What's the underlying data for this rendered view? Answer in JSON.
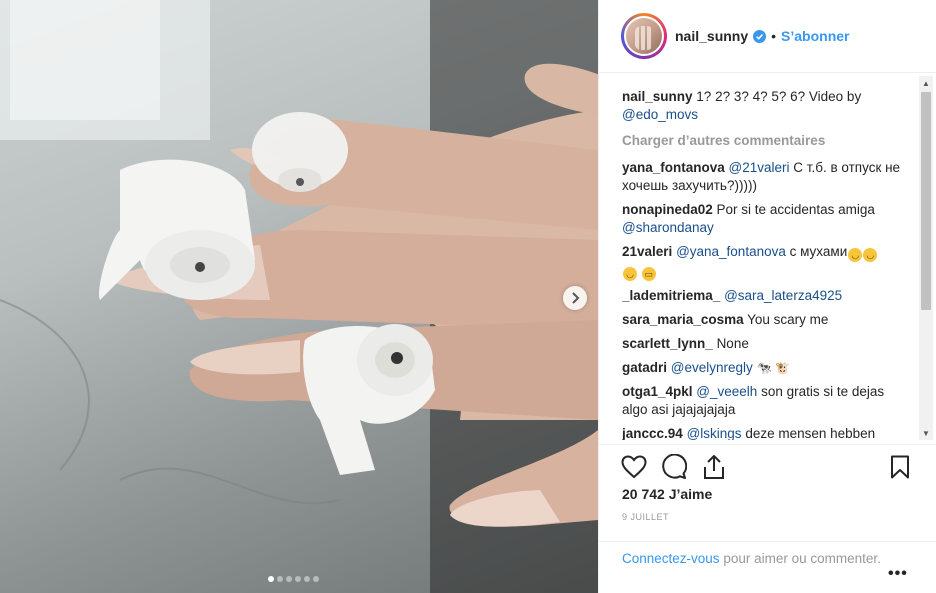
{
  "post": {
    "username": "nail_sunny",
    "separator": "•",
    "follow_label": "S’abonner"
  },
  "caption": {
    "user": "nail_sunny",
    "text": "1? 2? 3? 4? 5? 6? Video by",
    "mention": "@edo_movs"
  },
  "load_more_label": "Charger d’autres commentaires",
  "comments": [
    {
      "user": "yana_fontanova",
      "mention": "@21valeri",
      "text": "С т.б. в отпуск не хочешь захучить?)))))"
    },
    {
      "user": "nonapineda02",
      "text": "Por si te accidentas amiga",
      "mention": "@sharondanay"
    },
    {
      "user": "21valeri",
      "mention": "@yana_fontanova",
      "text": "с мухами"
    },
    {
      "user": "_lademitriema_",
      "mention": "@sara_laterza4925"
    },
    {
      "user": "sara_maria_cosma",
      "text": "You scary me"
    },
    {
      "user": "scarlett_lynn_",
      "text": "None"
    },
    {
      "user": "gatadri",
      "mention": "@evelynregly"
    },
    {
      "user": "otga1_4pkl",
      "mention": "@_veeelh",
      "text": "son gratis si te dejas algo asi jajajajajaja"
    },
    {
      "user": "janccc.94",
      "mention": "@lskings",
      "text": "deze mensen hebben"
    }
  ],
  "likes": "20 742 J’aime",
  "date": "9 JUILLET",
  "login": {
    "link": "Connectez-vous",
    "text": "pour aimer ou commenter."
  },
  "more_label": "•••",
  "icons": {
    "verified": "verified-badge-icon",
    "like": "heart-icon",
    "comment": "comment-bubble-icon",
    "share": "share-icon",
    "save": "bookmark-icon",
    "next": "chevron-right-icon"
  },
  "colors": {
    "accent": "#3897f0",
    "mention": "#1b4f8a",
    "muted": "#999999"
  },
  "carousel": {
    "count": 6,
    "active_index": 0
  }
}
